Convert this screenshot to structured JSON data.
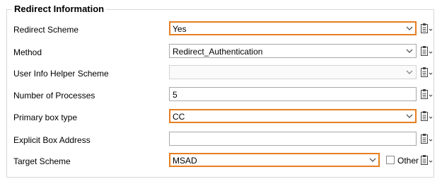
{
  "group_title": "Redirect Information",
  "rows": [
    {
      "label": "Redirect Scheme",
      "value": "Yes",
      "type": "select",
      "highlighted": true
    },
    {
      "label": "Method",
      "value": "Redirect_Authentication",
      "type": "select",
      "highlighted": false
    },
    {
      "label": "User Info Helper Scheme",
      "value": "",
      "type": "select",
      "highlighted": false,
      "disabled": true
    },
    {
      "label": "Number of Processes",
      "value": "5",
      "type": "text",
      "highlighted": false
    },
    {
      "label": "Primary box type",
      "value": "CC",
      "type": "select",
      "highlighted": true
    },
    {
      "label": "Explicit Box Address",
      "value": "",
      "type": "text",
      "highlighted": false
    },
    {
      "label": "Target Scheme",
      "value": "MSAD",
      "type": "select",
      "highlighted": true
    }
  ],
  "other_checkbox": {
    "label": "Other",
    "checked": false
  },
  "icons": {
    "dropdown": "chevron-down-icon",
    "action": "clipboard-menu-icon"
  },
  "colors": {
    "highlight_border": "#e67e22",
    "group_border": "#d7d7d7"
  }
}
